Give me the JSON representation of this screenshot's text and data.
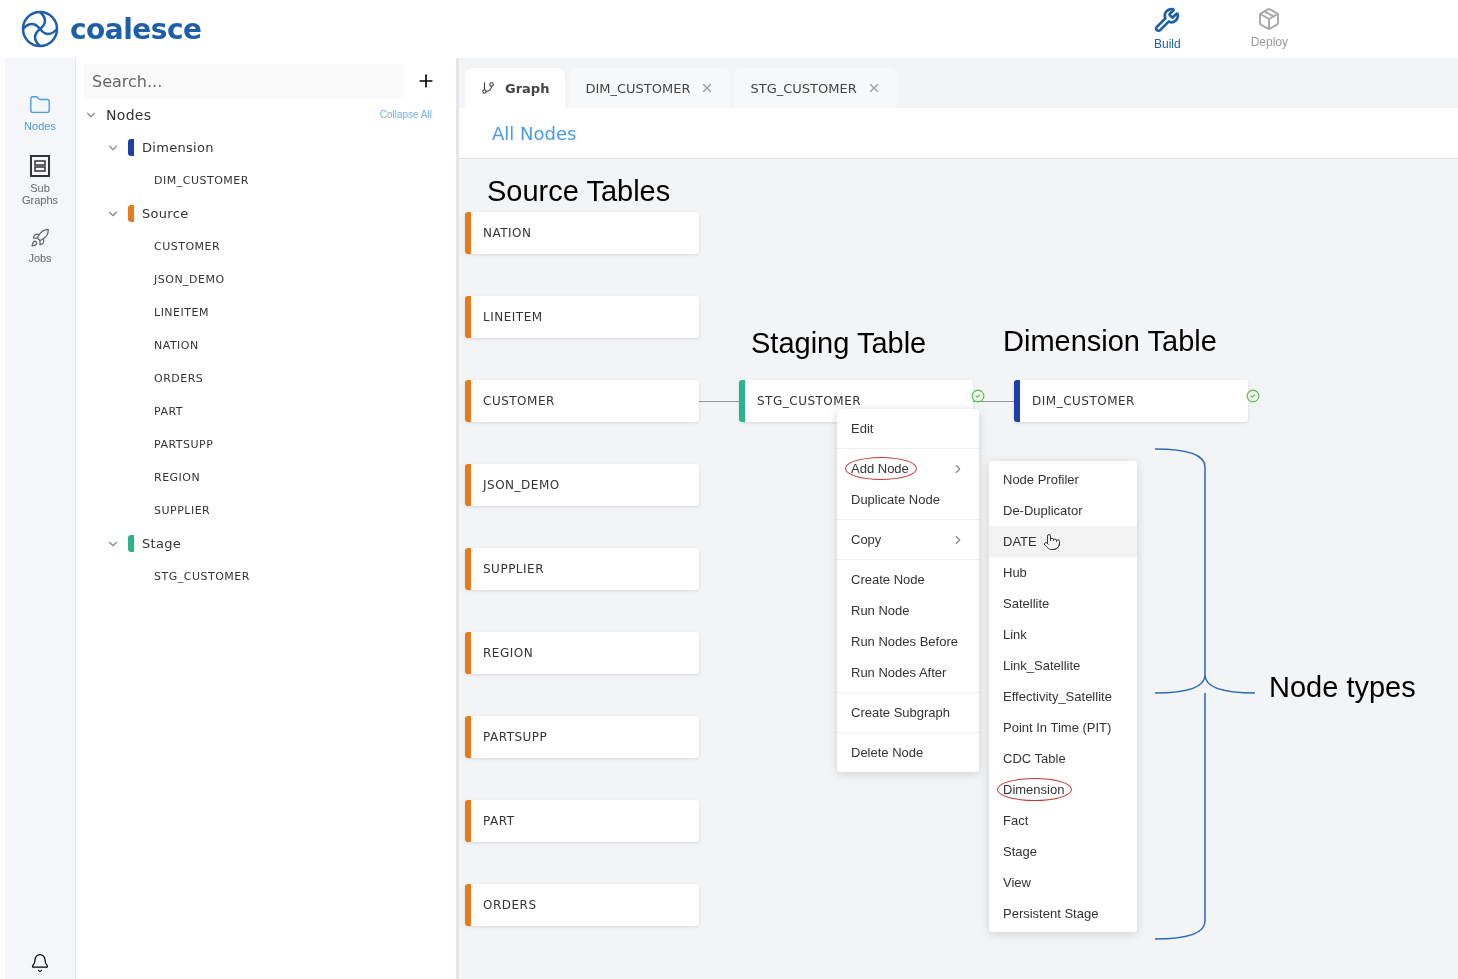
{
  "header": {
    "logo": "coalesce",
    "nav": [
      {
        "label": "Build",
        "selected": true,
        "kind": "build"
      },
      {
        "label": "Deploy",
        "selected": false,
        "kind": "deploy"
      }
    ]
  },
  "rail": {
    "items": [
      {
        "label": "Nodes",
        "selected": true,
        "kind": "folder"
      },
      {
        "label": "Sub Graphs",
        "selected": false,
        "kind": "subgraph"
      },
      {
        "label": "Jobs",
        "selected": false,
        "kind": "rocket"
      }
    ]
  },
  "tree": {
    "search": {
      "placeholder": "Search..."
    },
    "root": {
      "label": "Nodes",
      "expanded": true,
      "action": "Collapse All",
      "children": [
        {
          "label": "Dimension",
          "color": "#1f3fa8",
          "expanded": true,
          "children": [
            "DIM_CUSTOMER"
          ]
        },
        {
          "label": "Source",
          "color": "#e87b1c",
          "expanded": true,
          "children": [
            "CUSTOMER",
            "JSON_DEMO",
            "LINEITEM",
            "NATION",
            "ORDERS",
            "PART",
            "PARTSUPP",
            "REGION",
            "SUPPLIER"
          ]
        },
        {
          "label": "Stage",
          "color": "#2bb58a",
          "expanded": true,
          "children": [
            "STG_CUSTOMER"
          ]
        }
      ]
    }
  },
  "tabs": [
    {
      "label": "Graph",
      "selected": true,
      "closable": false
    },
    {
      "label": "DIM_CUSTOMER",
      "selected": false,
      "closable": true
    },
    {
      "label": "STG_CUSTOMER",
      "selected": false,
      "closable": true
    }
  ],
  "breadcrumb": "All Nodes",
  "canvas": {
    "annotations": [
      "Source Tables",
      "Staging Table",
      "Dimension Table",
      "Node types"
    ],
    "nodes": [
      {
        "label": "NATION",
        "color": "#e87b1c",
        "validated": false
      },
      {
        "label": "LINEITEM",
        "color": "#e87b1c",
        "validated": false
      },
      {
        "label": "CUSTOMER",
        "color": "#e87b1c",
        "validated": false
      },
      {
        "label": "JSON_DEMO",
        "color": "#e87b1c",
        "validated": false
      },
      {
        "label": "SUPPLIER",
        "color": "#e87b1c",
        "validated": false
      },
      {
        "label": "REGION",
        "color": "#e87b1c",
        "validated": false
      },
      {
        "label": "PARTSUPP",
        "color": "#e87b1c",
        "validated": false
      },
      {
        "label": "PART",
        "color": "#e87b1c",
        "validated": false
      },
      {
        "label": "ORDERS",
        "color": "#e87b1c",
        "validated": false
      },
      {
        "label": "STG_CUSTOMER",
        "color": "#2bb58a",
        "validated": true
      },
      {
        "label": "DIM_CUSTOMER",
        "color": "#1f3fa8",
        "validated": true
      }
    ],
    "context_menu": {
      "groups": [
        [
          {
            "label": "Edit",
            "submenu": false,
            "circled": false
          }
        ],
        [
          {
            "label": "Add Node",
            "submenu": true,
            "circled": true
          },
          {
            "label": "Duplicate Node",
            "submenu": false,
            "circled": false
          }
        ],
        [
          {
            "label": "Copy",
            "submenu": true,
            "circled": false
          }
        ],
        [
          {
            "label": "Create Node",
            "submenu": false,
            "circled": false
          },
          {
            "label": "Run Node",
            "submenu": false,
            "circled": false
          },
          {
            "label": "Run Nodes Before",
            "submenu": false,
            "circled": false
          },
          {
            "label": "Run Nodes After",
            "submenu": false,
            "circled": false
          }
        ],
        [
          {
            "label": "Create Subgraph",
            "submenu": false,
            "circled": false
          }
        ],
        [
          {
            "label": "Delete Node",
            "submenu": false,
            "circled": false
          }
        ]
      ]
    },
    "submenu": {
      "items": [
        {
          "label": "Node Profiler",
          "selected": false,
          "circled": false
        },
        {
          "label": "De-Duplicator",
          "selected": false,
          "circled": false
        },
        {
          "label": "DATE",
          "selected": true,
          "circled": false
        },
        {
          "label": "Hub",
          "selected": false,
          "circled": false
        },
        {
          "label": "Satellite",
          "selected": false,
          "circled": false
        },
        {
          "label": "Link",
          "selected": false,
          "circled": false
        },
        {
          "label": "Link_Satellite",
          "selected": false,
          "circled": false
        },
        {
          "label": "Effectivity_Satellite",
          "selected": false,
          "circled": false
        },
        {
          "label": "Point In Time (PIT)",
          "selected": false,
          "circled": false
        },
        {
          "label": "CDC Table",
          "selected": false,
          "circled": false
        },
        {
          "label": "Dimension",
          "selected": false,
          "circled": true
        },
        {
          "label": "Fact",
          "selected": false,
          "circled": false
        },
        {
          "label": "Stage",
          "selected": false,
          "circled": false
        },
        {
          "label": "View",
          "selected": false,
          "circled": false
        },
        {
          "label": "Persistent Stage",
          "selected": false,
          "circled": false
        }
      ]
    }
  }
}
